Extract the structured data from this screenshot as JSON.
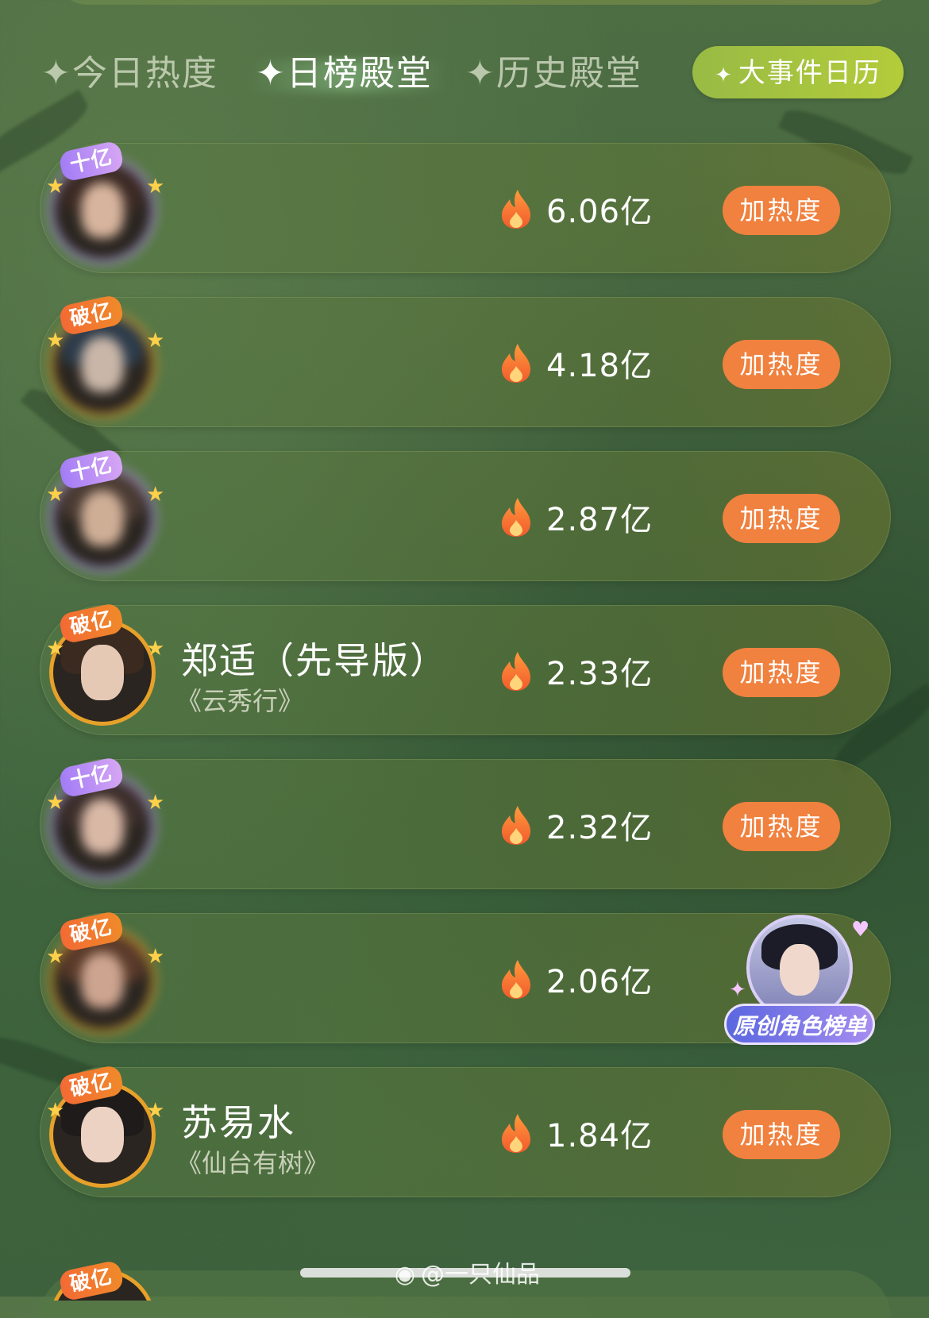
{
  "tabs": [
    {
      "label": "✦今日热度",
      "active": false
    },
    {
      "label": "✦日榜殿堂",
      "active": true
    },
    {
      "label": "✦历史殿堂",
      "active": false
    }
  ],
  "calendar_button": {
    "star": "✦",
    "label": "大事件日历"
  },
  "rows": [
    {
      "rank": 1,
      "name": "",
      "work": "",
      "heat": "6.06亿",
      "button": "加热度",
      "badge": "十亿",
      "badge_style": "purple",
      "blurred": true
    },
    {
      "rank": 2,
      "name": "",
      "work": "",
      "heat": "4.18亿",
      "button": "加热度",
      "badge": "破亿",
      "badge_style": "orange",
      "blurred": true
    },
    {
      "rank": 3,
      "name": "",
      "work": "",
      "heat": "2.87亿",
      "button": "加热度",
      "badge": "十亿",
      "badge_style": "purple",
      "blurred": true
    },
    {
      "rank": 4,
      "name": "郑适（先导版）",
      "work": "《云秀行》",
      "heat": "2.33亿",
      "button": "加热度",
      "badge": "破亿",
      "badge_style": "orange",
      "blurred": false
    },
    {
      "rank": 5,
      "name": "",
      "work": "",
      "heat": "2.32亿",
      "button": "加热度",
      "badge": "十亿",
      "badge_style": "purple",
      "blurred": true
    },
    {
      "rank": 6,
      "name": "",
      "work": "",
      "heat": "2.06亿",
      "button": "加热度",
      "badge": "破亿",
      "badge_style": "orange",
      "blurred": true
    },
    {
      "rank": 7,
      "name": "苏易水",
      "work": "《仙台有树》",
      "heat": "1.84亿",
      "button": "加热度",
      "badge": "破亿",
      "badge_style": "orange",
      "blurred": false
    },
    {
      "rank": 8,
      "name": "",
      "work": "",
      "heat": "",
      "button": "",
      "badge": "破亿",
      "badge_style": "orange",
      "blurred": true
    }
  ],
  "floating_entry": {
    "label": "原创角色榜单",
    "icon": "character-avatar-icon"
  },
  "watermark": {
    "icon": "weibo-icon",
    "text": "@一只仙品"
  },
  "colors": {
    "accent_orange": "#f0813e",
    "calendar_green": "#a6c240",
    "badge_purple": "#a27cf6"
  }
}
